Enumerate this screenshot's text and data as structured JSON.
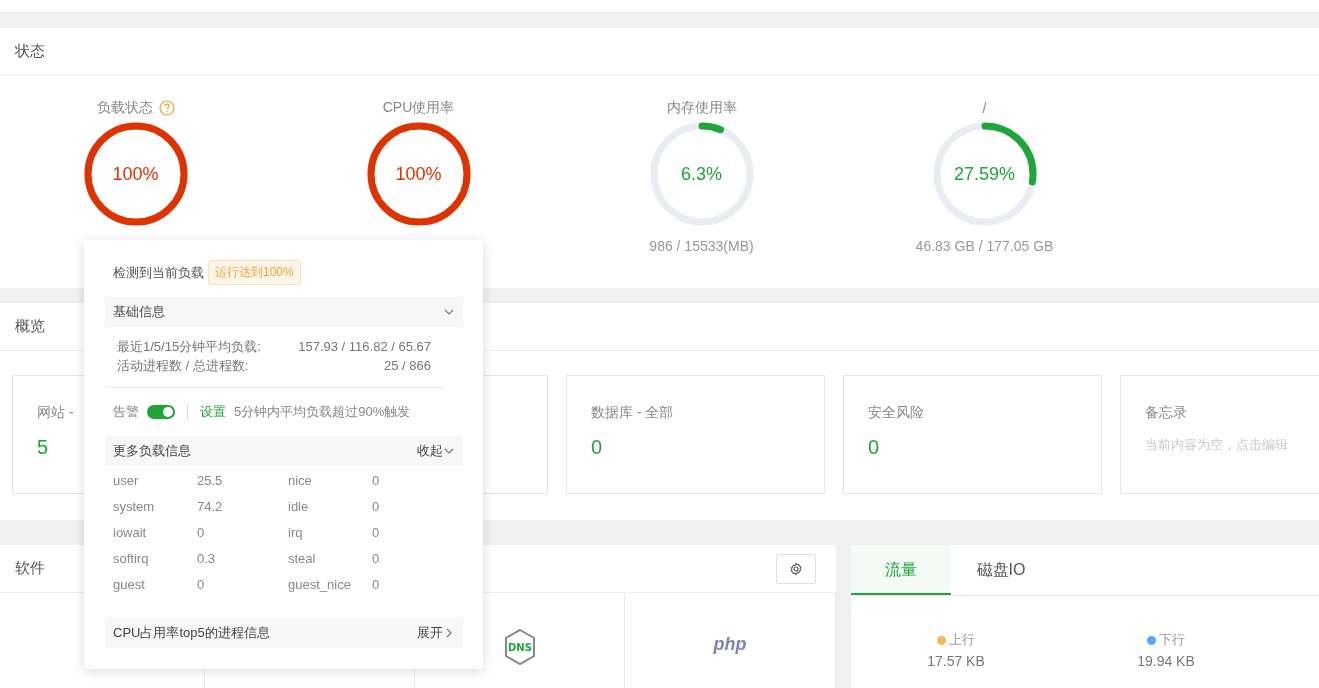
{
  "status": {
    "title": "状态",
    "gauges": [
      {
        "label": "负载状态",
        "has_help": true,
        "level": 1,
        "value_text": "100%"
      },
      {
        "label": "CPU使用率",
        "has_help": false,
        "level": 1,
        "value_text": "100%"
      },
      {
        "label": "内存使用率",
        "has_help": false,
        "level": 0.063,
        "value_text": "6.3%",
        "detail": "986 / 15533(MB)"
      },
      {
        "label": "/",
        "has_help": false,
        "level": 0.2759,
        "value_text": "27.59%",
        "detail": "46.83 GB / 177.05 GB"
      }
    ]
  },
  "overview": {
    "title": "概览",
    "cards": [
      {
        "kind": "count",
        "label": "网站 -",
        "value": "5"
      },
      {
        "kind": "blank"
      },
      {
        "kind": "count",
        "label": "数据库 - 全部",
        "value": "0"
      },
      {
        "kind": "count",
        "label": "安全风险",
        "value": "0"
      },
      {
        "kind": "note",
        "label": "备忘录",
        "value": "当前内容为空，点击编辑"
      }
    ]
  },
  "software": {
    "title": "软件",
    "tiles": [
      {
        "kind": "blank"
      },
      {
        "kind": "blank"
      },
      {
        "kind": "dns",
        "text": "DNS"
      },
      {
        "kind": "php",
        "text": "php"
      }
    ]
  },
  "traffic": {
    "tabs": [
      {
        "label": "流量",
        "selected": true
      },
      {
        "label": "磁盘IO",
        "selected": false
      }
    ],
    "legend": [
      {
        "label": "上行",
        "color": "#f7b851",
        "value": "17.57 KB"
      },
      {
        "label": "下行",
        "color": "#52a9ff",
        "value": "19.94 KB"
      }
    ]
  },
  "popover": {
    "heading": "检测到当前负载",
    "badge": "运行达到100%",
    "basic": {
      "title": "基础信息",
      "rows": [
        {
          "label": "最近1/5/15分钟平均负载:",
          "value": "157.93 / 116.82 / 65.67"
        },
        {
          "label": "活动进程数 / 总进程数:",
          "value": "25 / 866"
        }
      ]
    },
    "alarm": {
      "label": "告警",
      "on": true,
      "link": "设置",
      "text": "5分钟内平均负载超过90%触发"
    },
    "more": {
      "title": "更多负载信息",
      "action": "收起",
      "rows": [
        [
          "user",
          "25.5",
          "nice",
          "0"
        ],
        [
          "system",
          "74.2",
          "idle",
          "0"
        ],
        [
          "iowait",
          "0",
          "irq",
          "0"
        ],
        [
          "softirq",
          "0.3",
          "steal",
          "0"
        ],
        [
          "guest",
          "0",
          "guest_nice",
          "0"
        ]
      ]
    },
    "top": {
      "title": "CPU占用率top5的进程信息",
      "action": "展开"
    }
  }
}
